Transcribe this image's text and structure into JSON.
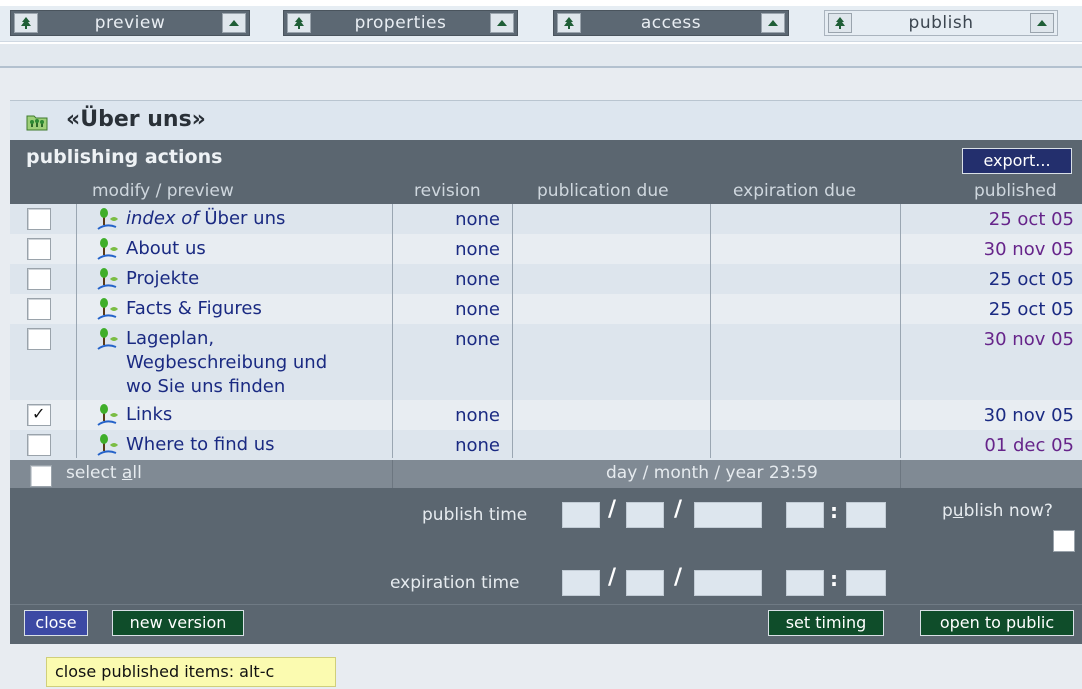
{
  "tabs": [
    {
      "label": "preview",
      "active": false
    },
    {
      "label": "properties",
      "active": false
    },
    {
      "label": "access",
      "active": false
    },
    {
      "label": "publish",
      "active": true
    }
  ],
  "page": {
    "title": "«Über uns»",
    "section_title": "publishing actions",
    "export_label": "export..."
  },
  "columns": {
    "modify": "modify / preview",
    "revision": "revision",
    "publication_due": "publication due",
    "expiration_due": "expiration due",
    "published": "published"
  },
  "rows": [
    {
      "checked": false,
      "title_prefix": "index of",
      "title": "Über uns",
      "revision": "none",
      "published": "25 oct 05",
      "published_color": "purple"
    },
    {
      "checked": false,
      "title": "About us",
      "revision": "none",
      "published": "30 nov 05",
      "published_color": "purple"
    },
    {
      "checked": false,
      "title": "Projekte",
      "revision": "none",
      "published": "25 oct 05",
      "published_color": "blue"
    },
    {
      "checked": false,
      "title": "Facts & Figures",
      "revision": "none",
      "published": "25 oct 05",
      "published_color": "blue"
    },
    {
      "checked": false,
      "title_lines": [
        "Lageplan,",
        "Wegbeschreibung und",
        "wo Sie uns finden"
      ],
      "revision": "none",
      "published": "30 nov 05",
      "published_color": "purple"
    },
    {
      "checked": true,
      "title": "Links",
      "revision": "none",
      "published": "30 nov 05",
      "published_color": "blue"
    },
    {
      "checked": false,
      "title": "Where to find us",
      "revision": "none",
      "published": "01 dec 05",
      "published_color": "purple"
    }
  ],
  "footer": {
    "select_all_pre": "select ",
    "select_all_u": "a",
    "select_all_post": "ll",
    "date_format": "day / month / year  23:59",
    "publish_time_label": "publish time",
    "expiration_time_label": "expiration time",
    "publish_now_pre": "p",
    "publish_now_u": "u",
    "publish_now_post": "blish now?"
  },
  "buttons": {
    "close": "close",
    "new_version": "new version",
    "set_timing": "set timing",
    "open_to_public": "open to public"
  },
  "tooltip": "close published items: alt-c",
  "colors": {
    "panel_dark": "#5b6670",
    "row_light": "#dde5ed",
    "link_blue": "#1a2a82",
    "date_purple": "#66248a",
    "btn_green": "#0f4d2a",
    "btn_blue": "#3c49a4",
    "btn_navy": "#232f6d"
  }
}
